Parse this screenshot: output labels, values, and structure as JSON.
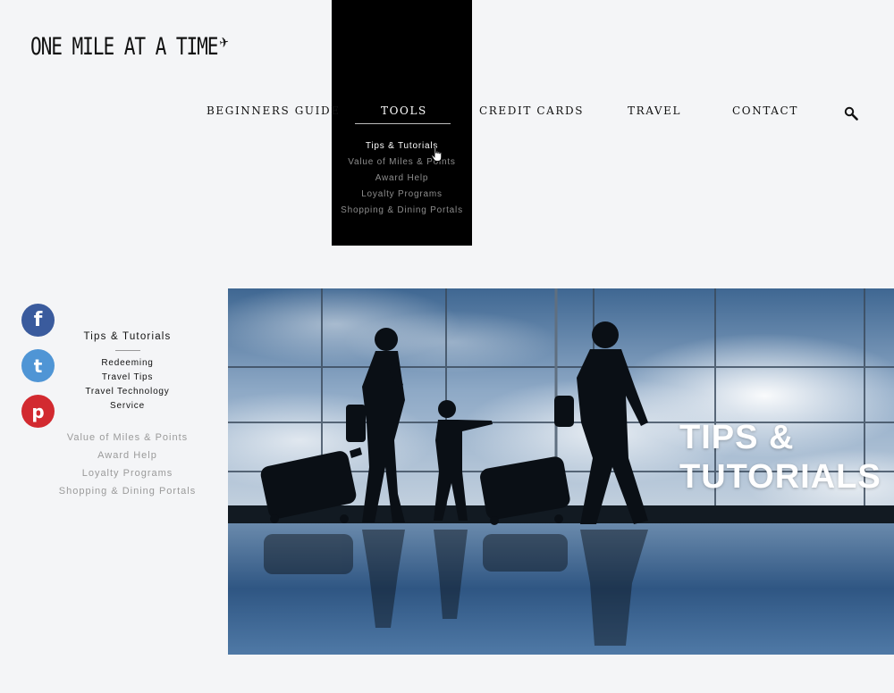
{
  "logo": {
    "text": "ONE MILE AT A TIME",
    "icon": "airplane-icon"
  },
  "nav": {
    "items": [
      {
        "label": "BEGINNERS GUIDE"
      },
      {
        "label": "TOOLS"
      },
      {
        "label": "CREDIT CARDS"
      },
      {
        "label": "TRAVEL"
      },
      {
        "label": "CONTACT"
      }
    ],
    "active": "TOOLS",
    "search_icon": "search-icon"
  },
  "tools_menu": {
    "items": [
      "Tips & Tutorials",
      "Value of Miles & Points",
      "Award Help",
      "Loyalty Programs",
      "Shopping & Dining Portals"
    ],
    "current": "Tips & Tutorials"
  },
  "social": {
    "facebook": "f",
    "twitter": "t",
    "pinterest": "p"
  },
  "side_nav": {
    "title": "Tips & Tutorials",
    "sub_items": [
      "Redeeming",
      "Travel Tips",
      "Travel Technology",
      "Service"
    ],
    "other_items": [
      "Value of Miles & Points",
      "Award Help",
      "Loyalty Programs",
      "Shopping & Dining Portals"
    ]
  },
  "hero": {
    "line1": "TIPS &",
    "line2": "TUTORIALS"
  },
  "colors": {
    "page_bg": "#f4f5f7",
    "dropdown_bg": "#000000",
    "facebook": "#3a5b9d",
    "twitter": "#4f95d5",
    "pinterest": "#d22a30"
  }
}
